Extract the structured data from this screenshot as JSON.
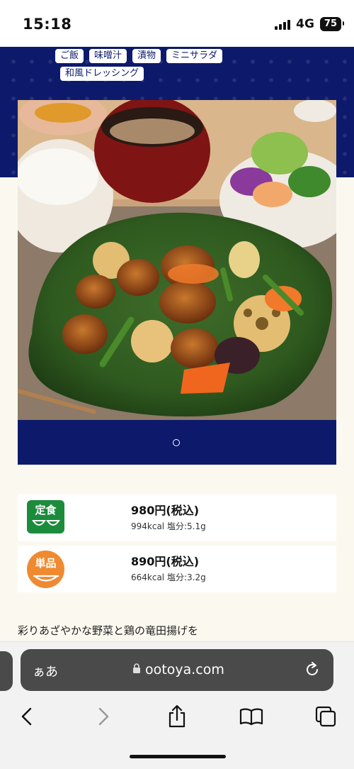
{
  "status_bar": {
    "time": "15:18",
    "network": "4G",
    "battery": "75"
  },
  "menu": {
    "tags_row1": [
      "ご飯",
      "味噌汁",
      "漬物",
      "ミニサラダ"
    ],
    "tags_row2": [
      "和風ドレッシング"
    ]
  },
  "carousel": {
    "dot_icon": "carousel-dot"
  },
  "prices": {
    "teishoku": {
      "badge": "定食",
      "price": "980円(税込)",
      "info": "994kcal 塩分:5.1g"
    },
    "tanpin": {
      "badge": "単品",
      "price": "890円(税込)",
      "info": "664kcal 塩分:3.2g"
    }
  },
  "description": "彩りあざやかな野菜と鶏の竜田揚げを",
  "browser": {
    "aa_label": "ぁあ",
    "url": "ootoya.com",
    "icons": [
      "lock-icon",
      "reload-icon",
      "back-icon",
      "forward-icon",
      "share-icon",
      "bookmarks-icon",
      "tabs-icon"
    ]
  },
  "colors": {
    "navy": "#0d1a6b",
    "green_badge": "#1c8b3c",
    "orange_badge": "#ef8a30",
    "page_bg": "#fbf8ef"
  }
}
